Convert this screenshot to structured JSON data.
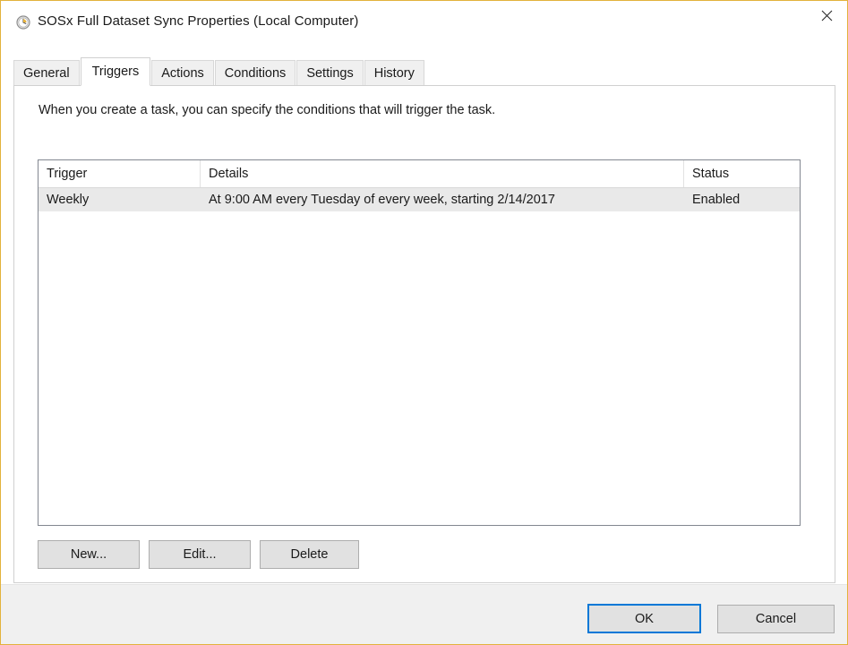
{
  "window": {
    "title": "SOSx Full Dataset Sync Properties (Local Computer)",
    "icon": "clock-icon",
    "close_label": "Close",
    "border_color": "#e3b23c"
  },
  "tabs": [
    {
      "label": "General",
      "active": false
    },
    {
      "label": "Triggers",
      "active": true
    },
    {
      "label": "Actions",
      "active": false
    },
    {
      "label": "Conditions",
      "active": false
    },
    {
      "label": "Settings",
      "active": false
    },
    {
      "label": "History",
      "active": false
    }
  ],
  "panel": {
    "description": "When you create a task, you can specify the conditions that will trigger the task.",
    "list": {
      "columns": [
        "Trigger",
        "Details",
        "Status"
      ],
      "rows": [
        {
          "trigger": "Weekly",
          "details": "At 9:00 AM every Tuesday of every week, starting 2/14/2017",
          "status": "Enabled",
          "selected": true
        }
      ]
    },
    "actions": {
      "new_label": "New...",
      "edit_label": "Edit...",
      "delete_label": "Delete"
    }
  },
  "footer": {
    "ok_label": "OK",
    "cancel_label": "Cancel",
    "focus_color": "#0078d7"
  }
}
